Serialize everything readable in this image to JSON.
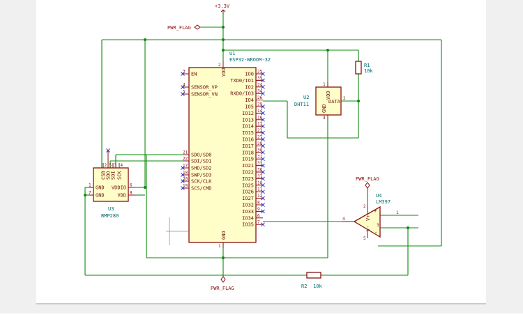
{
  "power": {
    "vcc_label": "+3.3V",
    "flag_top": "PWR_FLAG",
    "flag_bottom": "PWR_FLAG",
    "flag_right": "PWR_FLAG"
  },
  "u1": {
    "ref": "U1",
    "value": "ESP32-WROOM-32",
    "vdd": "VDD",
    "gnd": "GND",
    "vdd_num": "2",
    "gnd_num": "1",
    "left_pins": [
      {
        "label": "EN",
        "num": "3"
      },
      {
        "label": "SENSOR_VP",
        "num": "4"
      },
      {
        "label": "SENSOR_VN",
        "num": "5"
      },
      {
        "label": "SDO/SD0",
        "num": "21"
      },
      {
        "label": "SDI/SD1",
        "num": "22"
      },
      {
        "label": "SHD/SD2",
        "num": "17"
      },
      {
        "label": "SWP/SD3",
        "num": "18"
      },
      {
        "label": "SCK/CLK",
        "num": "20"
      },
      {
        "label": "SCS/CMD",
        "num": "19"
      }
    ],
    "right_pins": [
      {
        "label": "IO0",
        "num": "25"
      },
      {
        "label": "TXD0/IO1",
        "num": "35"
      },
      {
        "label": "IO2",
        "num": "24"
      },
      {
        "label": "RXD0/IO3",
        "num": "34"
      },
      {
        "label": "IO4",
        "num": "26"
      },
      {
        "label": "IO5",
        "num": "29"
      },
      {
        "label": "IO12",
        "num": "14"
      },
      {
        "label": "IO13",
        "num": "16"
      },
      {
        "label": "IO14",
        "num": "13"
      },
      {
        "label": "IO15",
        "num": "23"
      },
      {
        "label": "IO16",
        "num": "27"
      },
      {
        "label": "IO17",
        "num": "28"
      },
      {
        "label": "IO18",
        "num": "30"
      },
      {
        "label": "IO19",
        "num": "31"
      },
      {
        "label": "IO21",
        "num": "33"
      },
      {
        "label": "IO22",
        "num": "36"
      },
      {
        "label": "IO23",
        "num": "37"
      },
      {
        "label": "IO25",
        "num": "10"
      },
      {
        "label": "IO26",
        "num": "11"
      },
      {
        "label": "IO27",
        "num": "12"
      },
      {
        "label": "IO32",
        "num": "8"
      },
      {
        "label": "IO33",
        "num": "9"
      },
      {
        "label": "IO34",
        "num": "6"
      },
      {
        "label": "IO35",
        "num": "7"
      }
    ]
  },
  "u2": {
    "ref": "U2",
    "value": "DHT11",
    "vdd": "VDD",
    "gnd": "GND",
    "data": "DATA",
    "n1": "1",
    "n2": "2",
    "n4": "4"
  },
  "u3": {
    "ref": "U3",
    "value": "BMP280",
    "top_pins": [
      {
        "label": "CSB",
        "num": "2"
      },
      {
        "label": "SDO",
        "num": "5"
      },
      {
        "label": "SDI",
        "num": "3"
      },
      {
        "label": "SCK",
        "num": "4"
      }
    ],
    "left_pins": [
      {
        "label": "GND",
        "num": "1"
      },
      {
        "label": "GND",
        "num": "7"
      }
    ],
    "right_pins": [
      {
        "label": "VDDIO",
        "num": "6"
      },
      {
        "label": "VDD",
        "num": "8"
      }
    ]
  },
  "u4": {
    "ref": "U4",
    "value": "LM397",
    "n1": "1",
    "n2": "2",
    "n3": "3",
    "n4": "4",
    "n5": "5",
    "plus": "+",
    "minus": "-",
    "vplus": "V+",
    "vminus": "V-"
  },
  "r1": {
    "ref": "R1",
    "value": "10k"
  },
  "r2": {
    "ref": "R2",
    "value": "10k"
  }
}
